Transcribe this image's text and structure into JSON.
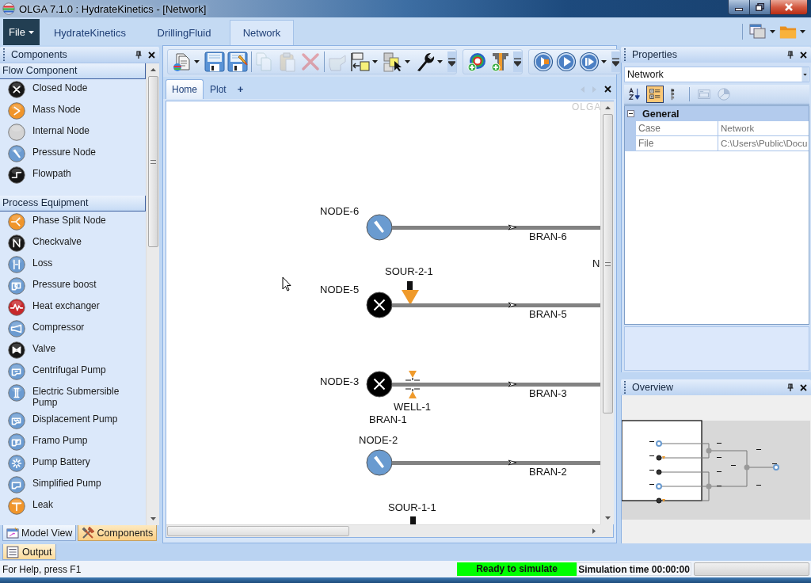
{
  "window": {
    "title": "OLGA 7.1.0 : HydrateKinetics - [Network]"
  },
  "menu": {
    "file": "File",
    "tabs": [
      {
        "label": "HydrateKinetics",
        "selected": false
      },
      {
        "label": "DrillingFluid",
        "selected": false
      },
      {
        "label": "Network",
        "selected": true
      }
    ]
  },
  "components": {
    "title": "Components",
    "groups": [
      {
        "label": "Flow Component",
        "items": [
          {
            "label": "Closed Node",
            "kind": "closed"
          },
          {
            "label": "Mass Node",
            "kind": "mass"
          },
          {
            "label": "Internal Node",
            "kind": "internal"
          },
          {
            "label": "Pressure Node",
            "kind": "pressure"
          },
          {
            "label": "Flowpath",
            "kind": "flowpath"
          }
        ]
      },
      {
        "label": "Process Equipment",
        "items": [
          {
            "label": "Phase Split Node",
            "kind": "phasesplit"
          },
          {
            "label": "Checkvalve",
            "kind": "checkvalve"
          },
          {
            "label": "Loss",
            "kind": "loss"
          },
          {
            "label": "Pressure boost",
            "kind": "boost"
          },
          {
            "label": "Heat exchanger",
            "kind": "heatexchanger"
          },
          {
            "label": "Compressor",
            "kind": "compressor"
          },
          {
            "label": "Valve",
            "kind": "valve"
          },
          {
            "label": "Centrifugal Pump",
            "kind": "centrifugal"
          },
          {
            "label": "Electric Submersible Pump",
            "kind": "esp"
          },
          {
            "label": "Displacement Pump",
            "kind": "displacement"
          },
          {
            "label": "Framo Pump",
            "kind": "framo"
          },
          {
            "label": "Pump Battery",
            "kind": "battery"
          },
          {
            "label": "Simplified Pump",
            "kind": "simplified"
          },
          {
            "label": "Leak",
            "kind": "leak"
          }
        ]
      }
    ],
    "tabs": [
      {
        "label": "Model View",
        "kind": "model",
        "selected": false
      },
      {
        "label": "Components",
        "kind": "tools",
        "selected": true
      }
    ]
  },
  "toolbar": [
    {
      "sections": [
        [
          {
            "kind": "new",
            "disabled": false,
            "dropdown": true
          },
          {
            "kind": "save",
            "disabled": false,
            "dropdown": false
          },
          {
            "kind": "saveas",
            "disabled": false,
            "dropdown": false
          }
        ],
        [
          {
            "kind": "copy",
            "disabled": true,
            "dropdown": false
          },
          {
            "kind": "paste",
            "disabled": true,
            "dropdown": false
          },
          {
            "kind": "delete",
            "disabled": true,
            "dropdown": false
          }
        ],
        [
          {
            "kind": "hand",
            "disabled": true,
            "dropdown": false
          },
          {
            "kind": "align",
            "disabled": false,
            "dropdown": true
          },
          {
            "kind": "select",
            "disabled": false,
            "dropdown": true
          },
          {
            "kind": "wrench",
            "disabled": false,
            "dropdown": true
          }
        ]
      ]
    },
    {
      "sections": [
        [
          {
            "kind": "ring",
            "disabled": false,
            "dropdown": false
          },
          {
            "kind": "pipe",
            "disabled": false,
            "dropdown": false
          }
        ]
      ]
    },
    {
      "sections": [
        [
          {
            "kind": "record",
            "disabled": false,
            "dropdown": false
          },
          {
            "kind": "play",
            "disabled": false,
            "dropdown": false
          },
          {
            "kind": "step",
            "disabled": false,
            "dropdown": true
          }
        ]
      ]
    }
  ],
  "document": {
    "tabs": [
      {
        "label": "Home",
        "selected": true
      },
      {
        "label": "Plot",
        "selected": false
      }
    ],
    "add_tab": "+",
    "canvas": {
      "logo": "OLGA",
      "nodes": [
        {
          "label": "NODE-6",
          "kind": "pressure"
        },
        {
          "label": "NODE-5",
          "kind": "closed"
        },
        {
          "label": "NODE-3",
          "kind": "closed"
        },
        {
          "label": "NODE-2",
          "kind": "pressure"
        }
      ],
      "branches": [
        {
          "label": "BRAN-6"
        },
        {
          "label": "BRAN-5"
        },
        {
          "label": "BRAN-3"
        },
        {
          "label": "BRAN-2"
        }
      ],
      "equipment": [
        {
          "label": "SOUR-2-1",
          "kind": "source"
        },
        {
          "label": "WELL-1",
          "kind": "well"
        },
        {
          "label": "SOUR-1-1",
          "kind": "stub"
        }
      ],
      "labels": [
        "BRAN-1",
        "N"
      ]
    }
  },
  "properties": {
    "title": "Properties",
    "object": "Network",
    "toolbar": [
      [
        {
          "kind": "alphabetical",
          "selected": false,
          "disabled": false
        },
        {
          "kind": "categorized",
          "selected": true,
          "disabled": false
        },
        {
          "kind": "tree",
          "selected": false,
          "disabled": false
        }
      ],
      [
        {
          "kind": "pages",
          "selected": false,
          "disabled": true
        },
        {
          "kind": "events",
          "selected": false,
          "disabled": true
        }
      ]
    ],
    "category": {
      "label": "General",
      "expanded": true
    },
    "rows": [
      {
        "name": "Case",
        "value": "Network"
      },
      {
        "name": "File",
        "value": "C:\\Users\\Public\\Docu"
      }
    ]
  },
  "overview": {
    "title": "Overview"
  },
  "output": {
    "label": "Output"
  },
  "status_bar": {
    "help": "For Help, press F1",
    "state": "Ready to simulate",
    "time": "Simulation time 00:00:00"
  }
}
